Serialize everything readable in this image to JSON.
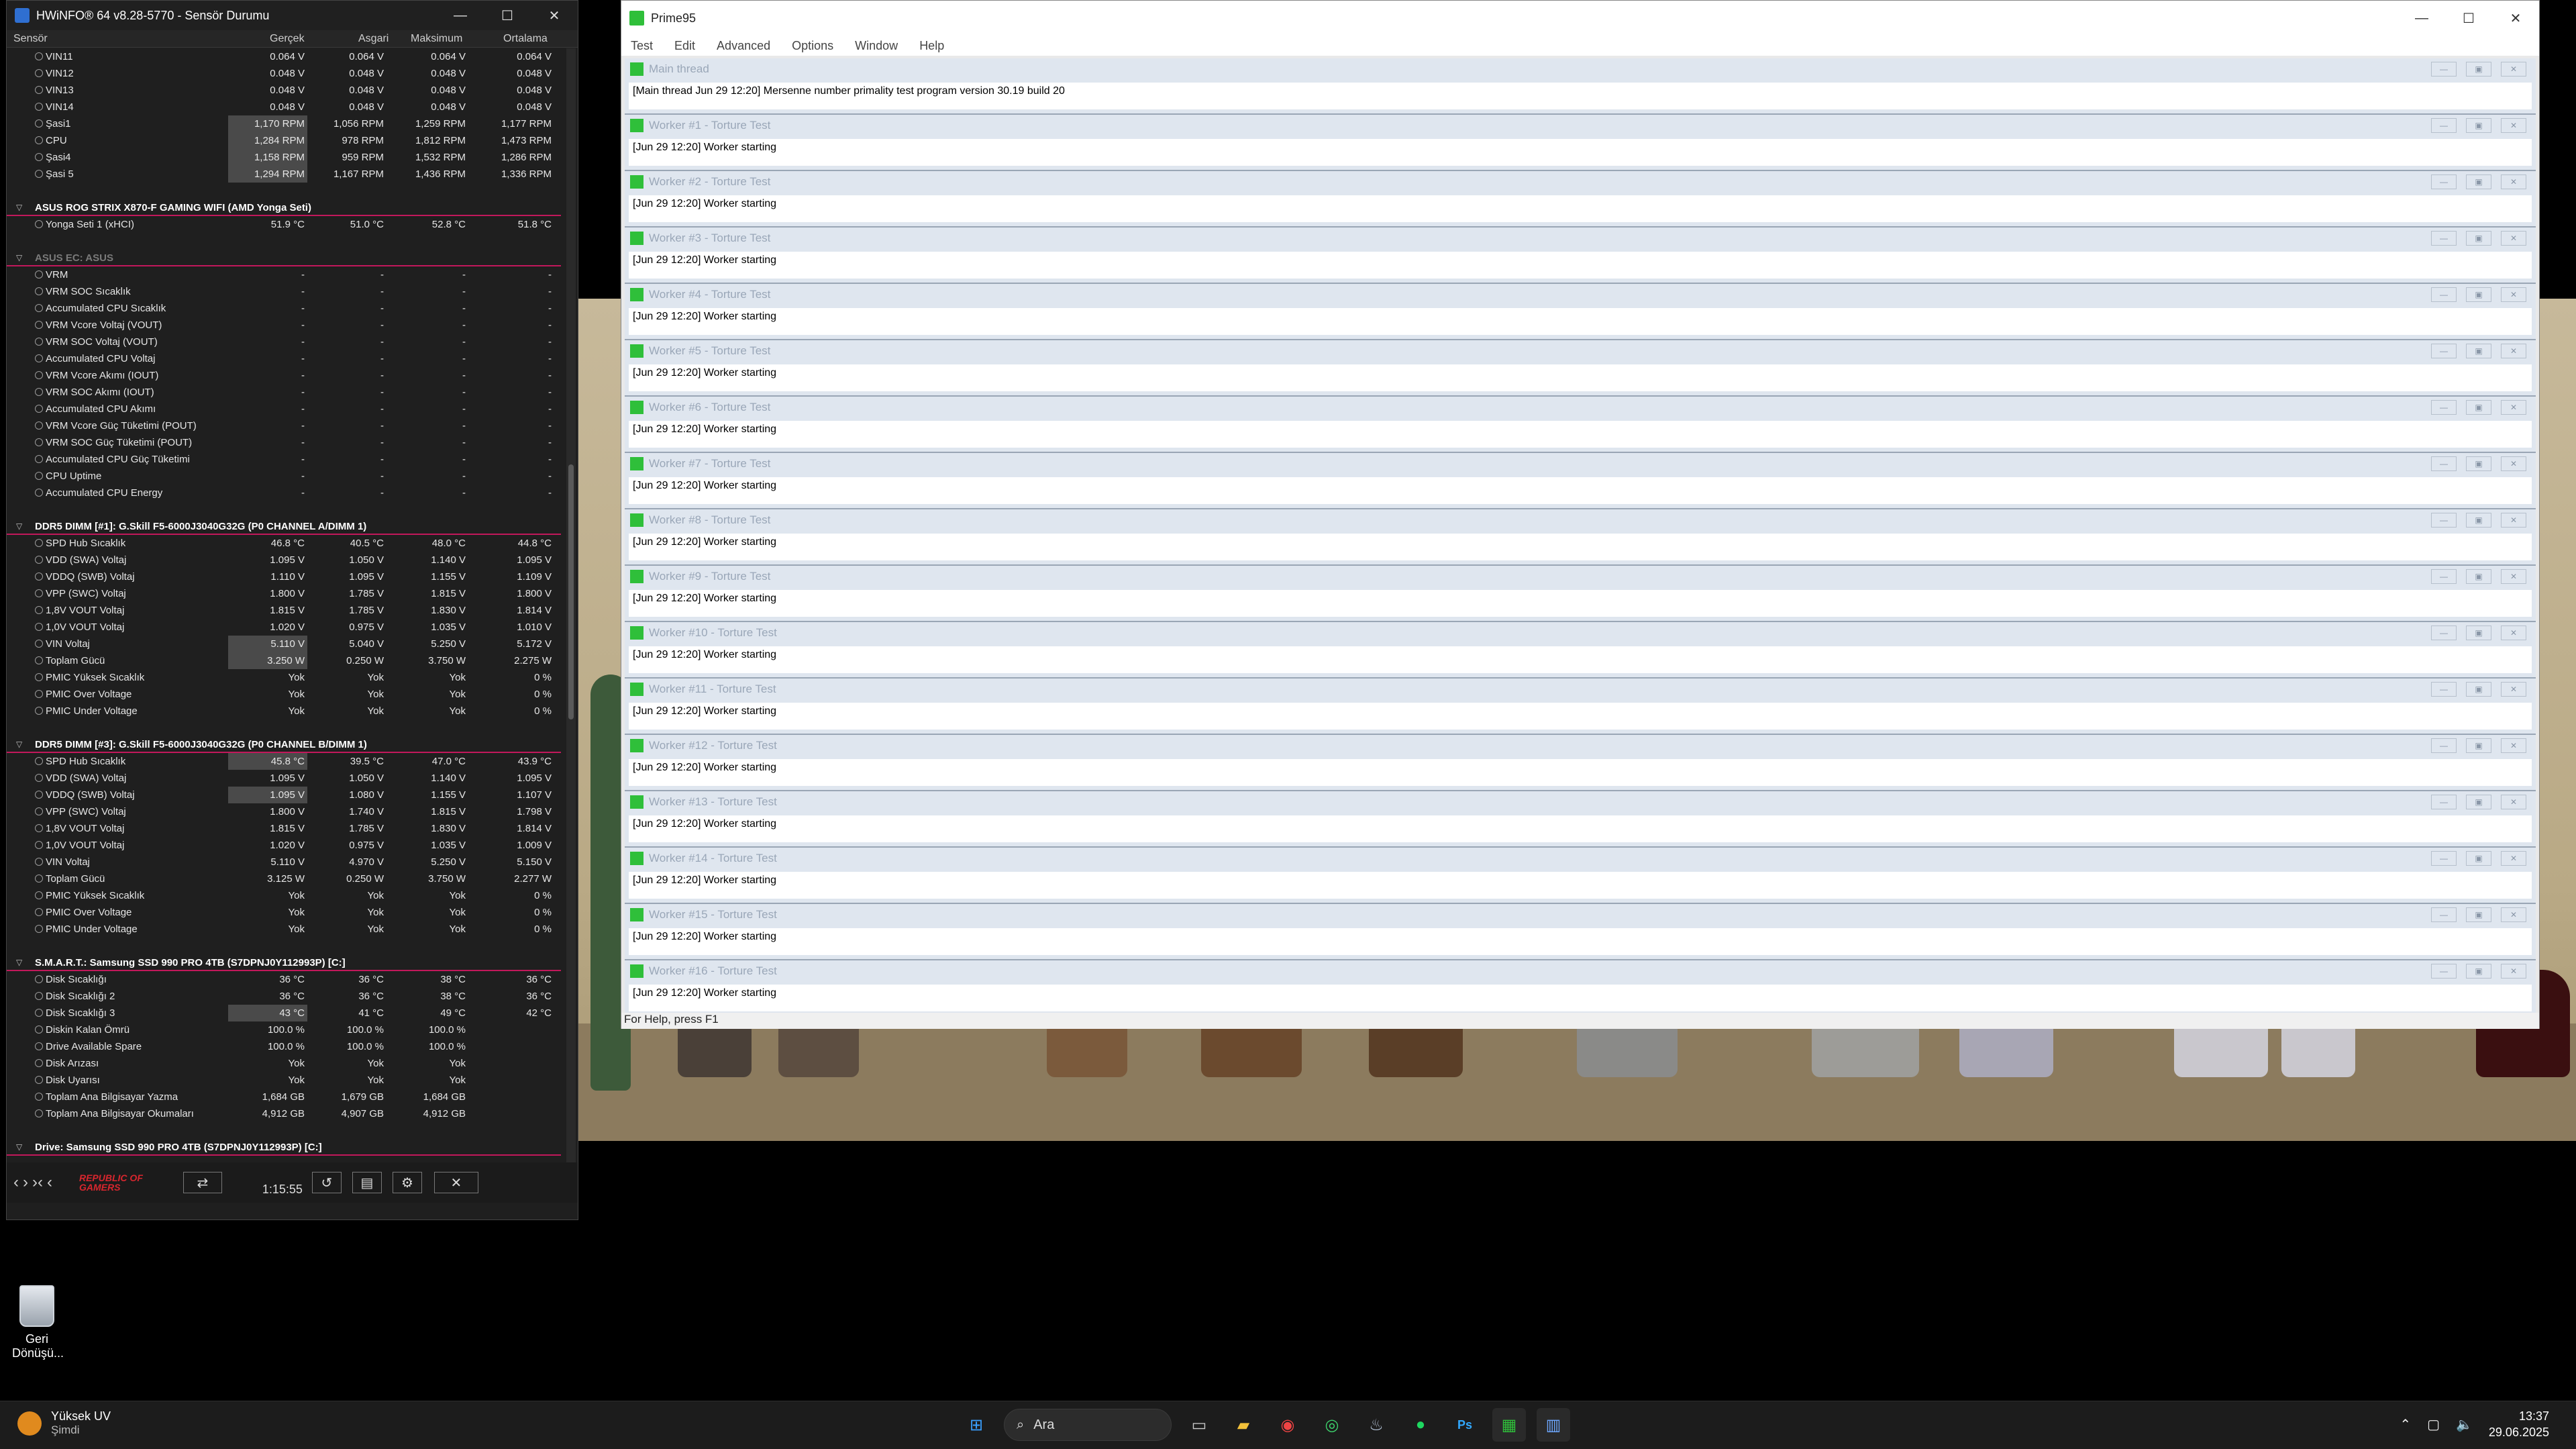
{
  "desktop": {
    "recycle_bin_label": "Geri Dönüşü..."
  },
  "hwinfo": {
    "title": "HWiNFO® 64 v8.28-5770 - Sensör Durumu",
    "columns": [
      "Sensör",
      "Gerçek",
      "Asgari",
      "Maksimum",
      "Ortalama"
    ],
    "rows": [
      {
        "name": "VIN11",
        "v": [
          "0.064 V",
          "0.064 V",
          "0.064 V",
          "0.064 V"
        ]
      },
      {
        "name": "VIN12",
        "v": [
          "0.048 V",
          "0.048 V",
          "0.048 V",
          "0.048 V"
        ]
      },
      {
        "name": "VIN13",
        "v": [
          "0.048 V",
          "0.048 V",
          "0.048 V",
          "0.048 V"
        ]
      },
      {
        "name": "VIN14",
        "v": [
          "0.048 V",
          "0.048 V",
          "0.048 V",
          "0.048 V"
        ]
      },
      {
        "name": "Şasi1",
        "v": [
          "1,170 RPM",
          "1,056 RPM",
          "1,259 RPM",
          "1,177 RPM"
        ],
        "hl": true
      },
      {
        "name": "CPU",
        "v": [
          "1,284 RPM",
          "978 RPM",
          "1,812 RPM",
          "1,473 RPM"
        ],
        "hl": true
      },
      {
        "name": "Şasi4",
        "v": [
          "1,158 RPM",
          "959 RPM",
          "1,532 RPM",
          "1,286 RPM"
        ],
        "hl": true
      },
      {
        "name": "Şasi 5",
        "v": [
          "1,294 RPM",
          "1,167 RPM",
          "1,436 RPM",
          "1,336 RPM"
        ],
        "hl": true
      },
      {
        "gap": true
      },
      {
        "group": "ASUS ROG STRIX X870-F GAMING WIFI (AMD Yonga Seti)"
      },
      {
        "name": "Yonga Seti 1 (xHCI)",
        "v": [
          "51.9 °C",
          "51.0 °C",
          "52.8 °C",
          "51.8 °C"
        ]
      },
      {
        "gap": true
      },
      {
        "group": "ASUS EC: ASUS",
        "dim": true
      },
      {
        "name": "VRM",
        "v": [
          "-",
          "-",
          "-",
          "-"
        ]
      },
      {
        "name": "VRM SOC Sıcaklık",
        "v": [
          "-",
          "-",
          "-",
          "-"
        ]
      },
      {
        "name": "Accumulated CPU Sıcaklık",
        "v": [
          "-",
          "-",
          "-",
          "-"
        ]
      },
      {
        "name": "VRM Vcore Voltaj (VOUT)",
        "v": [
          "-",
          "-",
          "-",
          "-"
        ]
      },
      {
        "name": "VRM SOC Voltaj (VOUT)",
        "v": [
          "-",
          "-",
          "-",
          "-"
        ]
      },
      {
        "name": "Accumulated CPU Voltaj",
        "v": [
          "-",
          "-",
          "-",
          "-"
        ]
      },
      {
        "name": "VRM Vcore Akımı (IOUT)",
        "v": [
          "-",
          "-",
          "-",
          "-"
        ]
      },
      {
        "name": "VRM SOC Akımı (IOUT)",
        "v": [
          "-",
          "-",
          "-",
          "-"
        ]
      },
      {
        "name": "Accumulated CPU Akımı",
        "v": [
          "-",
          "-",
          "-",
          "-"
        ]
      },
      {
        "name": "VRM Vcore Güç Tüketimi (POUT)",
        "v": [
          "-",
          "-",
          "-",
          "-"
        ]
      },
      {
        "name": "VRM SOC Güç Tüketimi (POUT)",
        "v": [
          "-",
          "-",
          "-",
          "-"
        ]
      },
      {
        "name": "Accumulated CPU Güç Tüketimi",
        "v": [
          "-",
          "-",
          "-",
          "-"
        ]
      },
      {
        "name": "CPU Uptime",
        "v": [
          "-",
          "-",
          "-",
          "-"
        ]
      },
      {
        "name": "Accumulated CPU Energy",
        "v": [
          "-",
          "-",
          "-",
          "-"
        ]
      },
      {
        "gap": true
      },
      {
        "group": "DDR5 DIMM [#1]: G.Skill F5-6000J3040G32G (P0 CHANNEL A/DIMM 1)"
      },
      {
        "name": "SPD Hub Sıcaklık",
        "v": [
          "46.8 °C",
          "40.5 °C",
          "48.0 °C",
          "44.8 °C"
        ]
      },
      {
        "name": "VDD (SWA) Voltaj",
        "v": [
          "1.095 V",
          "1.050 V",
          "1.140 V",
          "1.095 V"
        ]
      },
      {
        "name": "VDDQ (SWB) Voltaj",
        "v": [
          "1.110 V",
          "1.095 V",
          "1.155 V",
          "1.109 V"
        ]
      },
      {
        "name": "VPP (SWC) Voltaj",
        "v": [
          "1.800 V",
          "1.785 V",
          "1.815 V",
          "1.800 V"
        ]
      },
      {
        "name": "1,8V VOUT Voltaj",
        "v": [
          "1.815 V",
          "1.785 V",
          "1.830 V",
          "1.814 V"
        ]
      },
      {
        "name": "1,0V VOUT Voltaj",
        "v": [
          "1.020 V",
          "0.975 V",
          "1.035 V",
          "1.010 V"
        ]
      },
      {
        "name": "VIN Voltaj",
        "v": [
          "5.110 V",
          "5.040 V",
          "5.250 V",
          "5.172 V"
        ],
        "hl": true
      },
      {
        "name": "Toplam Gücü",
        "v": [
          "3.250 W",
          "0.250 W",
          "3.750 W",
          "2.275 W"
        ],
        "hl": true
      },
      {
        "name": "PMIC Yüksek Sıcaklık",
        "v": [
          "Yok",
          "Yok",
          "Yok",
          "0 %"
        ]
      },
      {
        "name": "PMIC Over Voltage",
        "v": [
          "Yok",
          "Yok",
          "Yok",
          "0 %"
        ]
      },
      {
        "name": "PMIC Under Voltage",
        "v": [
          "Yok",
          "Yok",
          "Yok",
          "0 %"
        ]
      },
      {
        "gap": true
      },
      {
        "group": "DDR5 DIMM [#3]: G.Skill F5-6000J3040G32G (P0 CHANNEL B/DIMM 1)"
      },
      {
        "name": "SPD Hub Sıcaklık",
        "v": [
          "45.8 °C",
          "39.5 °C",
          "47.0 °C",
          "43.9 °C"
        ],
        "hl": true
      },
      {
        "name": "VDD (SWA) Voltaj",
        "v": [
          "1.095 V",
          "1.050 V",
          "1.140 V",
          "1.095 V"
        ]
      },
      {
        "name": "VDDQ (SWB) Voltaj",
        "v": [
          "1.095 V",
          "1.080 V",
          "1.155 V",
          "1.107 V"
        ],
        "hl": true
      },
      {
        "name": "VPP (SWC) Voltaj",
        "v": [
          "1.800 V",
          "1.740 V",
          "1.815 V",
          "1.798 V"
        ]
      },
      {
        "name": "1,8V VOUT Voltaj",
        "v": [
          "1.815 V",
          "1.785 V",
          "1.830 V",
          "1.814 V"
        ]
      },
      {
        "name": "1,0V VOUT Voltaj",
        "v": [
          "1.020 V",
          "0.975 V",
          "1.035 V",
          "1.009 V"
        ]
      },
      {
        "name": "VIN Voltaj",
        "v": [
          "5.110 V",
          "4.970 V",
          "5.250 V",
          "5.150 V"
        ]
      },
      {
        "name": "Toplam Gücü",
        "v": [
          "3.125 W",
          "0.250 W",
          "3.750 W",
          "2.277 W"
        ]
      },
      {
        "name": "PMIC Yüksek Sıcaklık",
        "v": [
          "Yok",
          "Yok",
          "Yok",
          "0 %"
        ]
      },
      {
        "name": "PMIC Over Voltage",
        "v": [
          "Yok",
          "Yok",
          "Yok",
          "0 %"
        ]
      },
      {
        "name": "PMIC Under Voltage",
        "v": [
          "Yok",
          "Yok",
          "Yok",
          "0 %"
        ]
      },
      {
        "gap": true
      },
      {
        "group": "S.M.A.R.T.: Samsung SSD 990 PRO 4TB (S7DPNJ0Y112993P) [C:]"
      },
      {
        "name": "Disk Sıcaklığı",
        "v": [
          "36 °C",
          "36 °C",
          "38 °C",
          "36 °C"
        ]
      },
      {
        "name": "Disk Sıcaklığı 2",
        "v": [
          "36 °C",
          "36 °C",
          "38 °C",
          "36 °C"
        ]
      },
      {
        "name": "Disk Sıcaklığı 3",
        "v": [
          "43 °C",
          "41 °C",
          "49 °C",
          "42 °C"
        ],
        "hl": true
      },
      {
        "name": "Diskin Kalan Ömrü",
        "v": [
          "100.0 %",
          "100.0 %",
          "100.0 %",
          ""
        ]
      },
      {
        "name": "Drive Available Spare",
        "v": [
          "100.0 %",
          "100.0 %",
          "100.0 %",
          ""
        ]
      },
      {
        "name": "Disk Arızası",
        "v": [
          "Yok",
          "Yok",
          "Yok",
          ""
        ]
      },
      {
        "name": "Disk Uyarısı",
        "v": [
          "Yok",
          "Yok",
          "Yok",
          ""
        ]
      },
      {
        "name": "Toplam Ana Bilgisayar Yazma",
        "v": [
          "1,684 GB",
          "1,679 GB",
          "1,684 GB",
          ""
        ]
      },
      {
        "name": "Toplam Ana Bilgisayar Okumaları",
        "v": [
          "4,912 GB",
          "4,907 GB",
          "4,912 GB",
          ""
        ]
      },
      {
        "gap": true
      },
      {
        "group": "Drive: Samsung SSD 990 PRO 4TB (S7DPNJ0Y112993P) [C:]"
      }
    ],
    "footer_time": "1:15:55"
  },
  "prime95": {
    "title": "Prime95",
    "menu": [
      "Test",
      "Edit",
      "Advanced",
      "Options",
      "Window",
      "Help"
    ],
    "threads": [
      {
        "title": "Main thread",
        "text": "[Main thread Jun 29 12:20] Mersenne number primality test program version 30.19 build 20"
      },
      {
        "title": "Worker #1 - Torture Test",
        "text": "[Jun 29 12:20] Worker starting"
      },
      {
        "title": "Worker #2 - Torture Test",
        "text": "[Jun 29 12:20] Worker starting"
      },
      {
        "title": "Worker #3 - Torture Test",
        "text": "[Jun 29 12:20] Worker starting"
      },
      {
        "title": "Worker #4 - Torture Test",
        "text": "[Jun 29 12:20] Worker starting"
      },
      {
        "title": "Worker #5 - Torture Test",
        "text": "[Jun 29 12:20] Worker starting"
      },
      {
        "title": "Worker #6 - Torture Test",
        "text": "[Jun 29 12:20] Worker starting"
      },
      {
        "title": "Worker #7 - Torture Test",
        "text": "[Jun 29 12:20] Worker starting"
      },
      {
        "title": "Worker #8 - Torture Test",
        "text": "[Jun 29 12:20] Worker starting"
      },
      {
        "title": "Worker #9 - Torture Test",
        "text": "[Jun 29 12:20] Worker starting"
      },
      {
        "title": "Worker #10 - Torture Test",
        "text": "[Jun 29 12:20] Worker starting"
      },
      {
        "title": "Worker #11 - Torture Test",
        "text": "[Jun 29 12:20] Worker starting"
      },
      {
        "title": "Worker #12 - Torture Test",
        "text": "[Jun 29 12:20] Worker starting"
      },
      {
        "title": "Worker #13 - Torture Test",
        "text": "[Jun 29 12:20] Worker starting"
      },
      {
        "title": "Worker #14 - Torture Test",
        "text": "[Jun 29 12:20] Worker starting"
      },
      {
        "title": "Worker #15 - Torture Test",
        "text": "[Jun 29 12:20] Worker starting"
      },
      {
        "title": "Worker #16 - Torture Test",
        "text": "[Jun 29 12:20] Worker starting"
      }
    ],
    "status": "For Help, press F1"
  },
  "taskbar": {
    "weather_title": "Yüksek UV",
    "weather_sub": "Şimdi",
    "search_placeholder": "Ara",
    "time": "13:37",
    "date": "29.06.2025",
    "apps": [
      "task-view",
      "file-explorer",
      "chrome",
      "whatsapp",
      "steam",
      "spotify",
      "photoshop",
      "prime95",
      "hwinfo"
    ]
  }
}
